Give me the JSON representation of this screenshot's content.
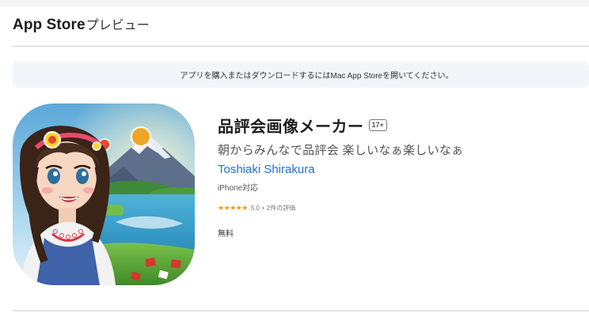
{
  "header": {
    "brand": "App Store",
    "suffix": "プレビュー"
  },
  "banner": {
    "text": "アプリを購入またはダウンロードするにはMac App Storeを開いてください。"
  },
  "app": {
    "title": "品評会画像メーカー",
    "age_rating": "17+",
    "subtitle": "朝からみんなで品評会 楽しいなぁ楽しいなぁ",
    "developer": "Toshiaki Shirakura",
    "compatibility": "iPhone対応",
    "stars": "★★★★★",
    "rating": "5.0",
    "rating_separator": "•",
    "rating_count": "2件の評価",
    "price": "無料",
    "icon_name": "anime-girl-mountain-lake-icon"
  },
  "colors": {
    "developer_link": "#1f6fd1",
    "star": "#ff9500",
    "banner_bg": "#f2f6fa"
  }
}
